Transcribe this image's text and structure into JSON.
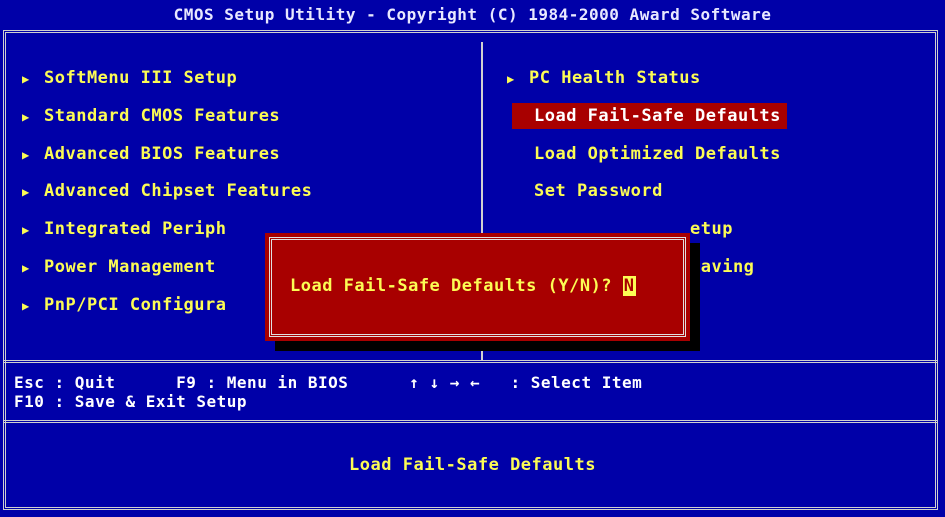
{
  "title": "CMOS Setup Utility - Copyright (C) 1984-2000 Award Software",
  "left_menu": [
    "SoftMenu III Setup",
    "Standard CMOS Features",
    "Advanced BIOS Features",
    "Advanced Chipset Features",
    "Integrated Periph",
    "Power Management",
    "PnP/PCI Configura"
  ],
  "right_menu": [
    "PC Health Status",
    "Load Fail-Safe Defaults",
    "Load Optimized Defaults",
    "Set Password",
    "etup",
    "Saving"
  ],
  "dialog": {
    "prompt": "Load Fail-Safe Defaults (Y/N)? ",
    "answer": "N"
  },
  "help": {
    "line1": "Esc : Quit      F9 : Menu in BIOS      ↑ ↓ → ←   : Select Item",
    "line2": "F10 : Save & Exit Setup"
  },
  "status_text": "Load Fail-Safe Defaults",
  "colors": {
    "background": "#0000a8",
    "highlight": "#a80000",
    "text": "#fcfc54"
  },
  "icons": {
    "menu_marker": "right-triangle-icon"
  }
}
